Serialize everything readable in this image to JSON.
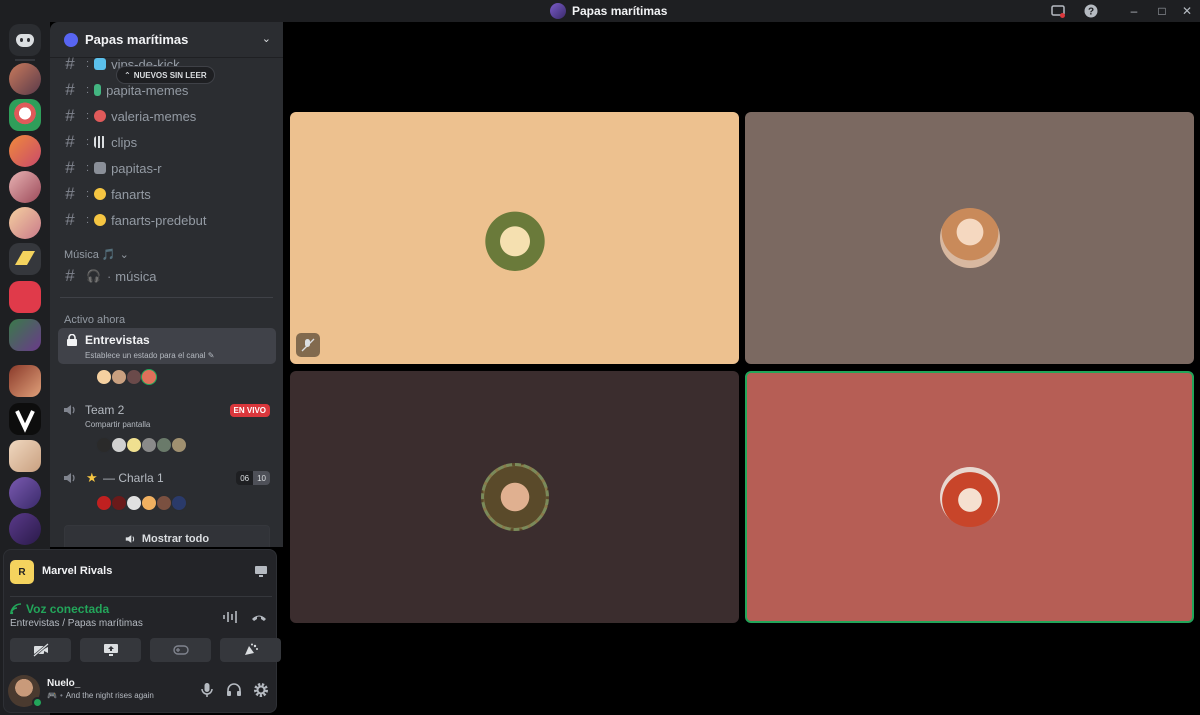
{
  "window": {
    "title": "Papas marítimas",
    "controls": {
      "minimize": "–",
      "maximize": "□",
      "close": "✕"
    }
  },
  "server": {
    "name": "Papas marítimas",
    "new_unread_label": "NUEVOS SIN LEER",
    "channels": [
      {
        "name": "vips-de-kick",
        "emoji_color": "#5bc0eb"
      },
      {
        "name": "papita-memes",
        "emoji_color": "#43b581"
      },
      {
        "name": "valeria-memes",
        "emoji_color": "#e05a5a"
      },
      {
        "name": "clips",
        "emoji_color": "#b5bac1"
      },
      {
        "name": "papitas-r",
        "emoji_color": "#8a8f98"
      },
      {
        "name": "fanarts",
        "emoji_color": "#f5c542"
      },
      {
        "name": "fanarts-predebut",
        "emoji_color": "#f5c542"
      }
    ],
    "music_category": "Música 🎵",
    "music_channel": "música",
    "active_now": "Activo ahora",
    "voice": {
      "entrevistas": {
        "name": "Entrevistas",
        "status": "Establece un estado para el canal"
      },
      "team2": {
        "name": "Team 2",
        "sub": "Compartir pantalla",
        "live": "EN VIVO"
      },
      "charla": {
        "name": "— Charla 1",
        "star": "★",
        "count_a": "06",
        "count_b": "10"
      }
    },
    "show_all": "Mostrar todo"
  },
  "panel": {
    "game": "Marvel Rivals",
    "game_icon_text": "R",
    "voice_status": "Voz conectada",
    "voice_channel": "Entrevistas / Papas marítimas",
    "user": {
      "name": "Nuelo_",
      "status": "And the night rises again"
    }
  },
  "colors": {
    "accent_green": "#23a55a",
    "live_red": "#da373c",
    "tile_1": "#edc18f",
    "tile_2": "#7b6961",
    "tile_3": "#3b2d2e",
    "tile_4": "#b65e55"
  },
  "icons": [
    "discord-icon",
    "hash-icon",
    "lock-icon",
    "speaker-icon",
    "camera-off-icon",
    "screen-share-icon",
    "gamepad-icon",
    "activity-icon",
    "mic-icon",
    "headphones-icon",
    "gear-icon",
    "soundboard-icon",
    "disconnect-icon",
    "help-icon",
    "inbox-icon"
  ]
}
